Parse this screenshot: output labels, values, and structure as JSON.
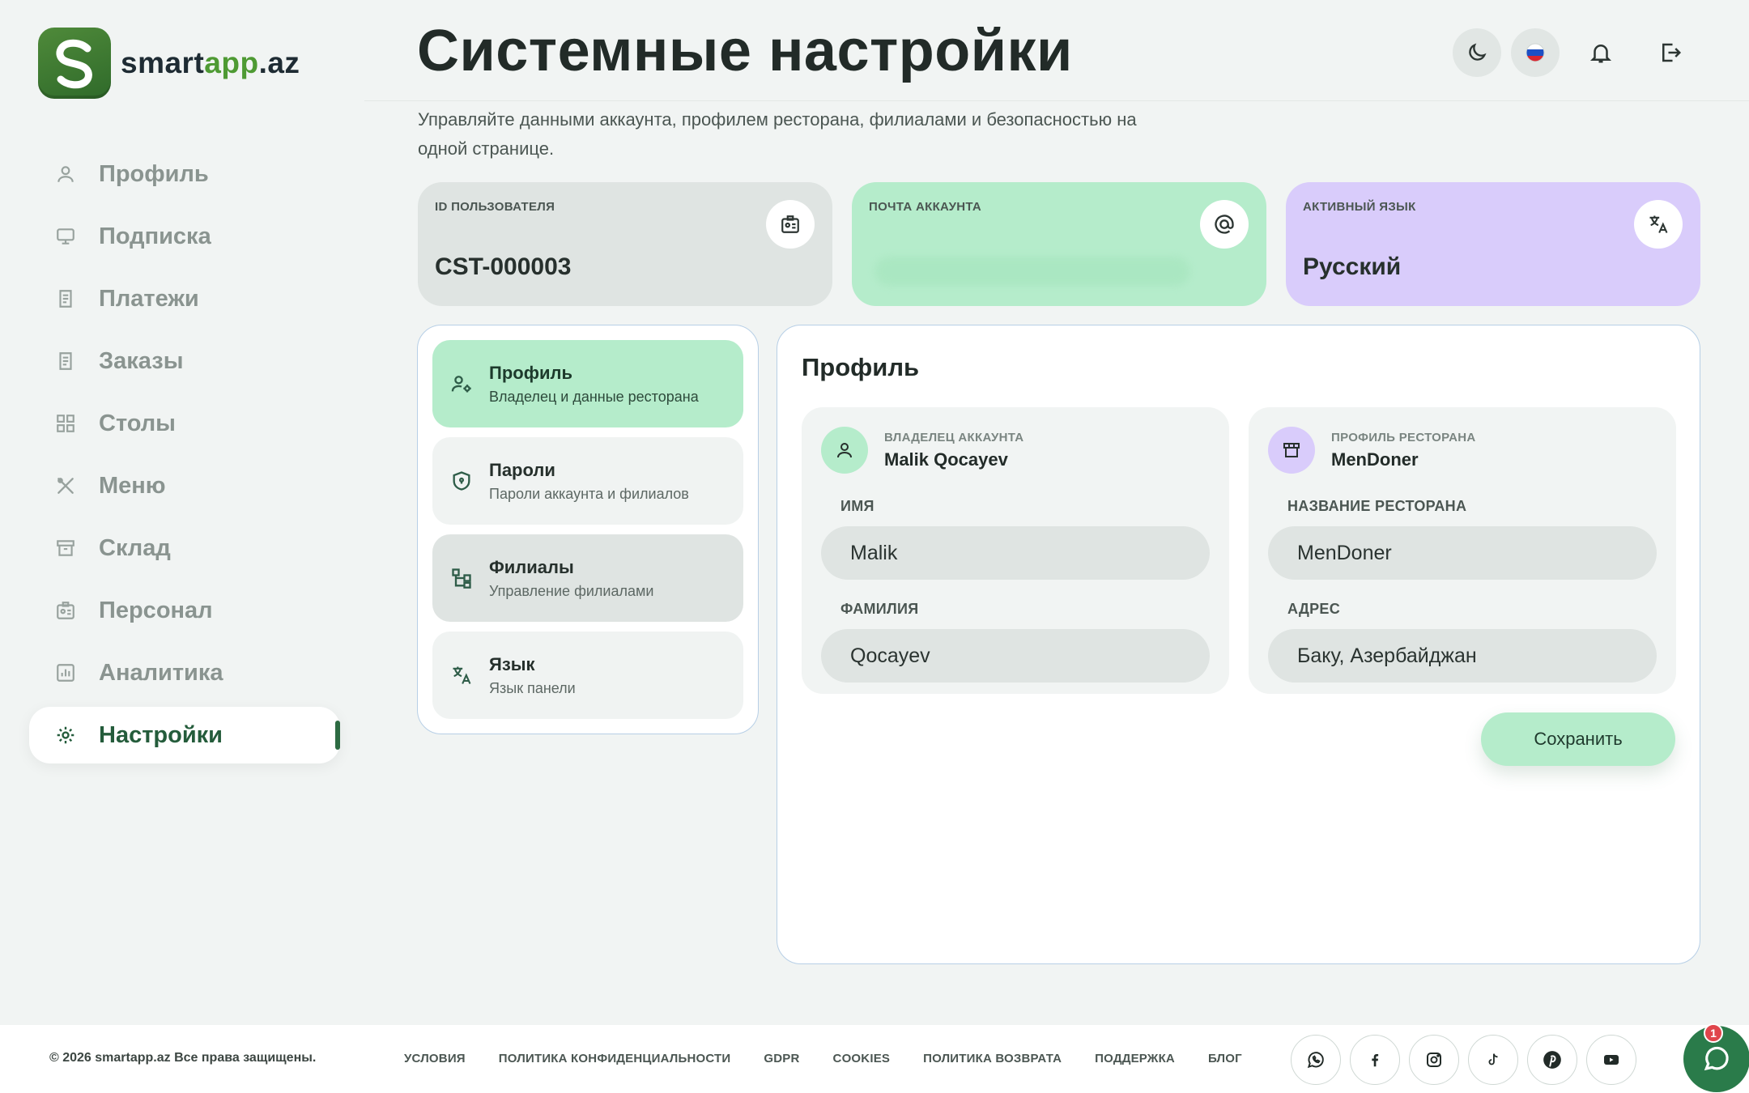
{
  "brand": {
    "logo_letter": "S",
    "name_part1": "smart",
    "name_part2": "app",
    "name_part3": ".az"
  },
  "sidebar": {
    "items": [
      {
        "label": "Профиль",
        "icon": "user-icon"
      },
      {
        "label": "Подписка",
        "icon": "subscription-icon"
      },
      {
        "label": "Платежи",
        "icon": "receipt-icon"
      },
      {
        "label": "Заказы",
        "icon": "orders-icon"
      },
      {
        "label": "Столы",
        "icon": "grid-icon"
      },
      {
        "label": "Меню",
        "icon": "utensils-icon"
      },
      {
        "label": "Склад",
        "icon": "archive-icon"
      },
      {
        "label": "Персонал",
        "icon": "badge-icon"
      },
      {
        "label": "Аналитика",
        "icon": "chart-icon"
      },
      {
        "label": "Настройки",
        "icon": "gear-icon",
        "active": true
      }
    ]
  },
  "header": {
    "title": "Системные настройки",
    "subtitle": "Управляйте данными аккаунта, профилем ресторана, филиалами и безопасностью на одной странице."
  },
  "stats": {
    "user_id": {
      "label": "ID ПОЛЬЗОВАТЕЛЯ",
      "value": "CST-000003"
    },
    "email": {
      "label": "ПОЧТА АККАУНТА",
      "value": ""
    },
    "language": {
      "label": "АКТИВНЫЙ ЯЗЫК",
      "value": "Русский"
    }
  },
  "settings_menu": [
    {
      "title": "Профиль",
      "subtitle": "Владелец и данные ресторана"
    },
    {
      "title": "Пароли",
      "subtitle": "Пароли аккаунта и филиалов"
    },
    {
      "title": "Филиалы",
      "subtitle": "Управление филиалами"
    },
    {
      "title": "Язык",
      "subtitle": "Язык панели"
    }
  ],
  "profile": {
    "title": "Профиль",
    "owner": {
      "caption": "ВЛАДЕЛЕЦ АККАУНТА",
      "name": "Malik Qocayev",
      "first_name_label": "ИМЯ",
      "first_name": "Malik",
      "last_name_label": "ФАМИЛИЯ",
      "last_name": "Qocayev"
    },
    "restaurant": {
      "caption": "ПРОФИЛЬ РЕСТОРАНА",
      "name": "MenDoner",
      "name_label": "НАЗВАНИЕ РЕСТОРАНА",
      "restaurant_name": "MenDoner",
      "address_label": "АДРЕС",
      "address": "Баку, Азербайджан"
    },
    "save_label": "Сохранить"
  },
  "footer": {
    "copyright": "© 2026 smartapp.az Все права защищены.",
    "links": [
      "УСЛОВИЯ",
      "ПОЛИТИКА КОНФИДЕНЦИАЛЬНОСТИ",
      "GDPR",
      "COOKIES",
      "ПОЛИТИКА ВОЗВРАТА",
      "ПОДДЕРЖКА",
      "БЛОГ"
    ],
    "socials": [
      "whatsapp-icon",
      "facebook-icon",
      "instagram-icon",
      "tiktok-icon",
      "pinterest-icon",
      "youtube-icon"
    ],
    "chat_badge": "1"
  },
  "colors": {
    "accent_green": "#b5eccb",
    "brand_green": "#2d6b42",
    "lavender": "#d9ccfb",
    "panel_border": "#b7cfe6"
  }
}
